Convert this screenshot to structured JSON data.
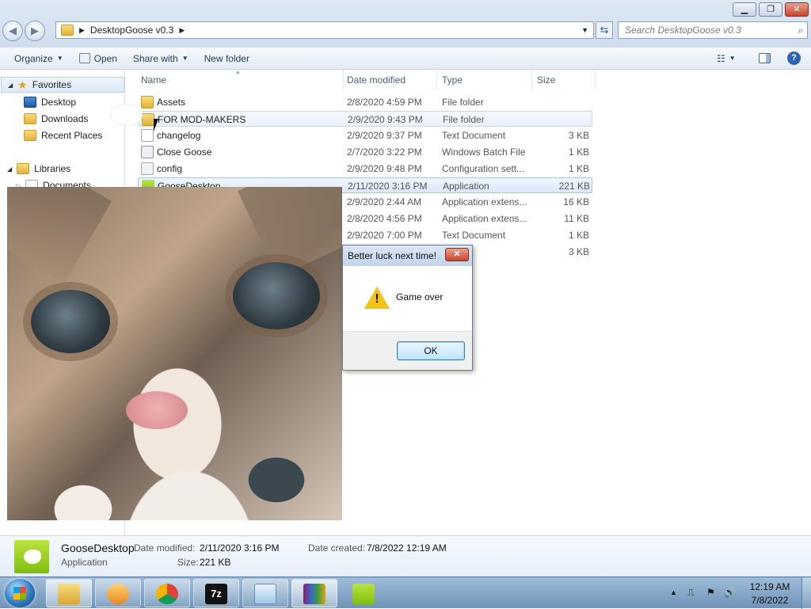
{
  "window": {
    "minimize": "▁",
    "maximize": "❐",
    "close": "✕"
  },
  "nav": {
    "back": "◀",
    "forward": "▶"
  },
  "address": {
    "path": "DesktopGoose v0.3"
  },
  "search": {
    "placeholder": "Search DesktopGoose v0.3"
  },
  "toolbar": {
    "organize": "Organize",
    "open": "Open",
    "share_with": "Share with",
    "new_folder": "New folder"
  },
  "sidebar": {
    "favorites": "Favorites",
    "items": [
      {
        "label": "Desktop"
      },
      {
        "label": "Downloads"
      },
      {
        "label": "Recent Places"
      }
    ],
    "libraries": "Libraries",
    "documents": "Documents"
  },
  "columns": {
    "name": "Name",
    "date": "Date modified",
    "type": "Type",
    "size": "Size"
  },
  "files": [
    {
      "name": "Assets",
      "date": "2/8/2020 4:59 PM",
      "type": "File folder",
      "size": "",
      "icon": "folder-icon"
    },
    {
      "name": "FOR MOD-MAKERS",
      "date": "2/9/2020 9:43 PM",
      "type": "File folder",
      "size": "",
      "icon": "folder-icon"
    },
    {
      "name": "changelog",
      "date": "2/9/2020 9:37 PM",
      "type": "Text Document",
      "size": "3 KB",
      "icon": "text-document-icon"
    },
    {
      "name": "Close Goose",
      "date": "2/7/2020 3:22 PM",
      "type": "Windows Batch File",
      "size": "1 KB",
      "icon": "batch-file-icon"
    },
    {
      "name": "config",
      "date": "2/9/2020 9:48 PM",
      "type": "Configuration sett...",
      "size": "1 KB",
      "icon": "config-file-icon"
    },
    {
      "name": "GooseDesktop",
      "date": "2/11/2020 3:16 PM",
      "type": "Application",
      "size": "221 KB",
      "icon": "application-icon"
    },
    {
      "name": "",
      "date": "2/9/2020 2:44 AM",
      "type": "Application extens...",
      "size": "16 KB",
      "icon": "dll-icon"
    },
    {
      "name": "",
      "date": "2/8/2020 4:56 PM",
      "type": "Application extens...",
      "size": "11 KB",
      "icon": "dll-icon"
    },
    {
      "name": "",
      "date": "2/9/2020 7:00 PM",
      "type": "Text Document",
      "size": "1 KB",
      "icon": "text-document-icon"
    },
    {
      "name": "",
      "date": "",
      "type": "cument",
      "size": "3 KB",
      "icon": "text-document-icon"
    }
  ],
  "dialog": {
    "title": "Better luck next time!",
    "message": "Game over",
    "ok": "OK"
  },
  "details": {
    "name": "GooseDesktop",
    "kind": "Application",
    "modified_label": "Date modified:",
    "modified_value": "2/11/2020 3:16 PM",
    "size_label": "Size:",
    "size_value": "221 KB",
    "created_label": "Date created:",
    "created_value": "7/8/2022 12:19 AM"
  },
  "taskbar": {
    "apps": [
      "explorer",
      "media-player",
      "chrome",
      "7zip",
      "notepad",
      "winrar",
      "desktop-goose"
    ],
    "tray_up": "▲",
    "time": "12:19 AM",
    "date": "7/8/2022"
  },
  "colors": {
    "accent": "#cfdcec",
    "selection": "#dbe8f8",
    "taskbar": "#6f93b8",
    "goose_green": "#8cc31a"
  }
}
